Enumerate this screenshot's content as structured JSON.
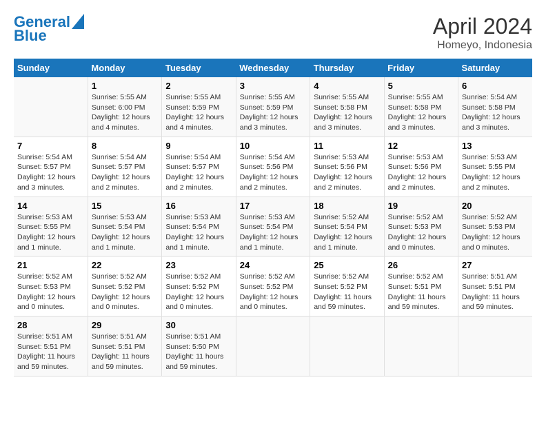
{
  "header": {
    "logo_line1": "General",
    "logo_line2": "Blue",
    "month": "April 2024",
    "location": "Homeyo, Indonesia"
  },
  "weekdays": [
    "Sunday",
    "Monday",
    "Tuesday",
    "Wednesday",
    "Thursday",
    "Friday",
    "Saturday"
  ],
  "weeks": [
    [
      {
        "day": "",
        "info": ""
      },
      {
        "day": "1",
        "info": "Sunrise: 5:55 AM\nSunset: 6:00 PM\nDaylight: 12 hours\nand 4 minutes."
      },
      {
        "day": "2",
        "info": "Sunrise: 5:55 AM\nSunset: 5:59 PM\nDaylight: 12 hours\nand 4 minutes."
      },
      {
        "day": "3",
        "info": "Sunrise: 5:55 AM\nSunset: 5:59 PM\nDaylight: 12 hours\nand 3 minutes."
      },
      {
        "day": "4",
        "info": "Sunrise: 5:55 AM\nSunset: 5:58 PM\nDaylight: 12 hours\nand 3 minutes."
      },
      {
        "day": "5",
        "info": "Sunrise: 5:55 AM\nSunset: 5:58 PM\nDaylight: 12 hours\nand 3 minutes."
      },
      {
        "day": "6",
        "info": "Sunrise: 5:54 AM\nSunset: 5:58 PM\nDaylight: 12 hours\nand 3 minutes."
      }
    ],
    [
      {
        "day": "7",
        "info": "Sunrise: 5:54 AM\nSunset: 5:57 PM\nDaylight: 12 hours\nand 3 minutes."
      },
      {
        "day": "8",
        "info": "Sunrise: 5:54 AM\nSunset: 5:57 PM\nDaylight: 12 hours\nand 2 minutes."
      },
      {
        "day": "9",
        "info": "Sunrise: 5:54 AM\nSunset: 5:57 PM\nDaylight: 12 hours\nand 2 minutes."
      },
      {
        "day": "10",
        "info": "Sunrise: 5:54 AM\nSunset: 5:56 PM\nDaylight: 12 hours\nand 2 minutes."
      },
      {
        "day": "11",
        "info": "Sunrise: 5:53 AM\nSunset: 5:56 PM\nDaylight: 12 hours\nand 2 minutes."
      },
      {
        "day": "12",
        "info": "Sunrise: 5:53 AM\nSunset: 5:56 PM\nDaylight: 12 hours\nand 2 minutes."
      },
      {
        "day": "13",
        "info": "Sunrise: 5:53 AM\nSunset: 5:55 PM\nDaylight: 12 hours\nand 2 minutes."
      }
    ],
    [
      {
        "day": "14",
        "info": "Sunrise: 5:53 AM\nSunset: 5:55 PM\nDaylight: 12 hours\nand 1 minute."
      },
      {
        "day": "15",
        "info": "Sunrise: 5:53 AM\nSunset: 5:54 PM\nDaylight: 12 hours\nand 1 minute."
      },
      {
        "day": "16",
        "info": "Sunrise: 5:53 AM\nSunset: 5:54 PM\nDaylight: 12 hours\nand 1 minute."
      },
      {
        "day": "17",
        "info": "Sunrise: 5:53 AM\nSunset: 5:54 PM\nDaylight: 12 hours\nand 1 minute."
      },
      {
        "day": "18",
        "info": "Sunrise: 5:52 AM\nSunset: 5:54 PM\nDaylight: 12 hours\nand 1 minute."
      },
      {
        "day": "19",
        "info": "Sunrise: 5:52 AM\nSunset: 5:53 PM\nDaylight: 12 hours\nand 0 minutes."
      },
      {
        "day": "20",
        "info": "Sunrise: 5:52 AM\nSunset: 5:53 PM\nDaylight: 12 hours\nand 0 minutes."
      }
    ],
    [
      {
        "day": "21",
        "info": "Sunrise: 5:52 AM\nSunset: 5:53 PM\nDaylight: 12 hours\nand 0 minutes."
      },
      {
        "day": "22",
        "info": "Sunrise: 5:52 AM\nSunset: 5:52 PM\nDaylight: 12 hours\nand 0 minutes."
      },
      {
        "day": "23",
        "info": "Sunrise: 5:52 AM\nSunset: 5:52 PM\nDaylight: 12 hours\nand 0 minutes."
      },
      {
        "day": "24",
        "info": "Sunrise: 5:52 AM\nSunset: 5:52 PM\nDaylight: 12 hours\nand 0 minutes."
      },
      {
        "day": "25",
        "info": "Sunrise: 5:52 AM\nSunset: 5:52 PM\nDaylight: 11 hours\nand 59 minutes."
      },
      {
        "day": "26",
        "info": "Sunrise: 5:52 AM\nSunset: 5:51 PM\nDaylight: 11 hours\nand 59 minutes."
      },
      {
        "day": "27",
        "info": "Sunrise: 5:51 AM\nSunset: 5:51 PM\nDaylight: 11 hours\nand 59 minutes."
      }
    ],
    [
      {
        "day": "28",
        "info": "Sunrise: 5:51 AM\nSunset: 5:51 PM\nDaylight: 11 hours\nand 59 minutes."
      },
      {
        "day": "29",
        "info": "Sunrise: 5:51 AM\nSunset: 5:51 PM\nDaylight: 11 hours\nand 59 minutes."
      },
      {
        "day": "30",
        "info": "Sunrise: 5:51 AM\nSunset: 5:50 PM\nDaylight: 11 hours\nand 59 minutes."
      },
      {
        "day": "",
        "info": ""
      },
      {
        "day": "",
        "info": ""
      },
      {
        "day": "",
        "info": ""
      },
      {
        "day": "",
        "info": ""
      }
    ]
  ]
}
